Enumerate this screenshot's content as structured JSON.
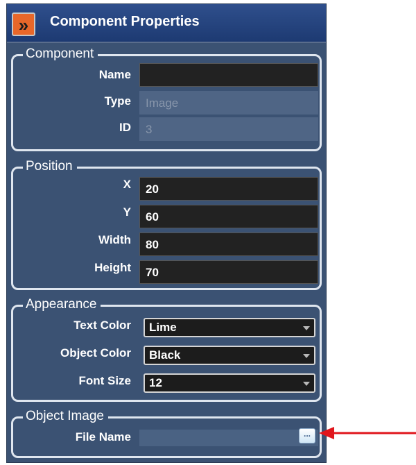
{
  "header": {
    "title": "Component Properties",
    "toggle_icon": "double-chevron-right-icon"
  },
  "component": {
    "legend": "Component",
    "name_label": "Name",
    "name_value": "",
    "type_label": "Type",
    "type_value": "Image",
    "id_label": "ID",
    "id_value": "3"
  },
  "position": {
    "legend": "Position",
    "x_label": "X",
    "x_value": "20",
    "y_label": "Y",
    "y_value": "60",
    "width_label": "Width",
    "width_value": "80",
    "height_label": "Height",
    "height_value": "70"
  },
  "appearance": {
    "legend": "Appearance",
    "text_color_label": "Text Color",
    "text_color_value": "Lime",
    "object_color_label": "Object Color",
    "object_color_value": "Black",
    "font_size_label": "Font Size",
    "font_size_value": "12"
  },
  "object_image": {
    "legend": "Object Image",
    "file_name_label": "File Name",
    "file_name_value": "",
    "browse_label": "..."
  },
  "colors": {
    "panel": "#3b5273",
    "header": "#1d3a72",
    "accent_button": "#e8672a",
    "arrow": "#e0161c"
  }
}
